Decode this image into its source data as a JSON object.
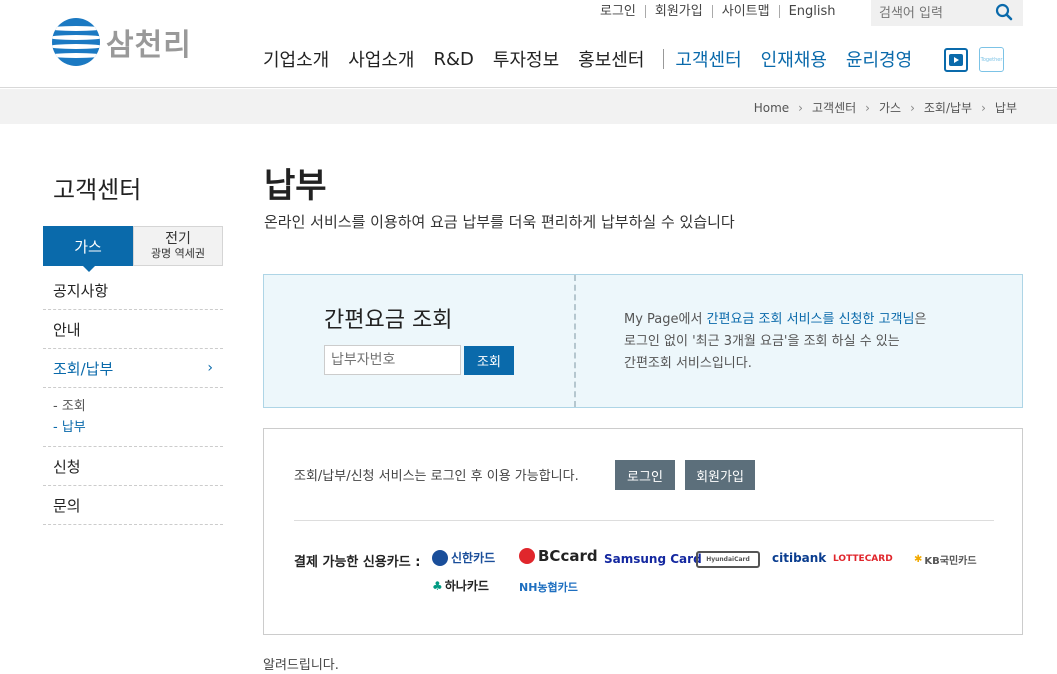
{
  "header": {
    "logo_text": "삼천리",
    "util_links": [
      "로그인",
      "회원가입",
      "사이트맵",
      "English"
    ],
    "search_placeholder": "검색어 입력",
    "gnb_main": [
      "기업소개",
      "사업소개",
      "R&D",
      "투자정보",
      "홍보센터"
    ],
    "gnb_blue": [
      "고객센터",
      "인재채용",
      "윤리경영"
    ],
    "together_label": "Together"
  },
  "breadcrumb": [
    "Home",
    "고객센터",
    "가스",
    "조회/납부",
    "납부"
  ],
  "sidebar": {
    "title": "고객센터",
    "tab_gas": "가스",
    "tab_elec_1": "전기",
    "tab_elec_2": "광명 역세권",
    "items": [
      "공지사항",
      "안내",
      "조회/납부",
      "신청",
      "문의"
    ],
    "sub_items": [
      "-  조회",
      "-  납부"
    ]
  },
  "main": {
    "title": "납부",
    "desc": "온라인 서비스를 이용하여 요금 납부를 더욱 편리하게 납부하실 수 있습니다",
    "quick": {
      "title": "간편요금 조회",
      "input_placeholder": "납부자번호",
      "button": "조회",
      "info_pre": "My Page에서 ",
      "info_hl": "간편요금 조회 서비스를 신청한 고객님",
      "info_post": "은",
      "info_line2": "로그인 없이 '최근 3개월 요금'을 조회 하실 수 있는",
      "info_line3": "간편조회 서비스입니다."
    },
    "service": {
      "message": "조회/납부/신청 서비스는 로그인 후 이용 가능합니다.",
      "login_btn": "로그인",
      "join_btn": "회원가입",
      "cards_label": "결제 가능한 신용카드 :",
      "cards": [
        "신한카드",
        "BCcard",
        "Samsung Card",
        "HyundaiCard",
        "citibank",
        "LOTTECARD",
        "KB국민카드",
        "하나카드",
        "NH농협카드"
      ]
    },
    "notice": "알려드립니다."
  }
}
